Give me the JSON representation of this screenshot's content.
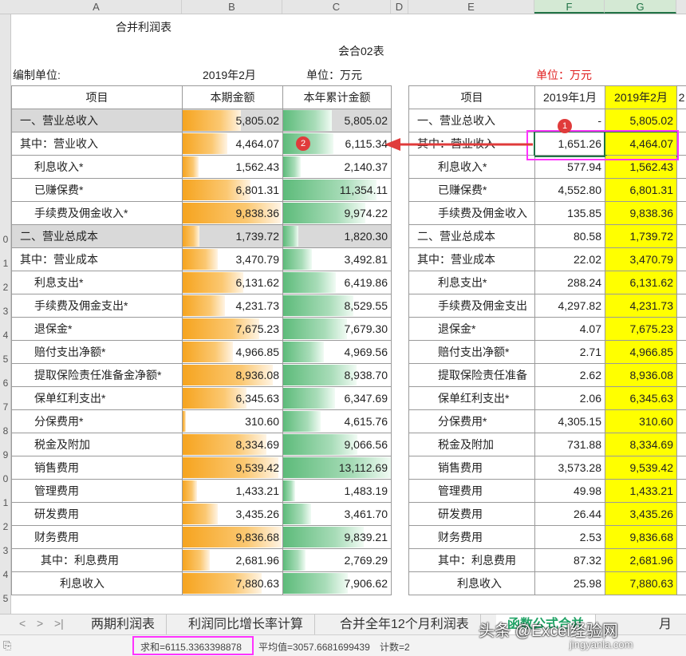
{
  "columns": [
    "A",
    "B",
    "C",
    "D",
    "E",
    "F",
    "G"
  ],
  "title": "合并利润表",
  "form_no": "会合02表",
  "left_meta": {
    "unit_prefix": "编制单位:",
    "period": "2019年2月",
    "unit": "单位：万元"
  },
  "right_unit": "单位：万元",
  "left_headers": [
    "项目",
    "本期金额",
    "本年累计金额"
  ],
  "right_headers": [
    "项目",
    "2019年1月",
    "2019年2月",
    "2"
  ],
  "row_numbers": [
    "",
    "",
    "",
    "",
    "",
    "",
    "",
    "",
    "",
    "0",
    "1",
    "2",
    "3",
    "4",
    "5",
    "6",
    "7",
    "8",
    "9",
    "0",
    "1",
    "2",
    "3",
    "4",
    "5"
  ],
  "rows": [
    {
      "label": "一、营业总收入",
      "right_label": "一、营业总收入",
      "cur": "5,805.02",
      "cum": "5,805.02",
      "jan": "-",
      "feb": "5,805.02",
      "cur_pct": 0.58,
      "cum_pct": 0.45,
      "gray": true
    },
    {
      "label": "其中：营业收入",
      "right_label": "其中：营业收入",
      "cur": "4,464.07",
      "cum": "6,115.34",
      "jan": "1,651.26",
      "feb": "4,464.07",
      "cur_pct": 0.45,
      "cum_pct": 0.47
    },
    {
      "label": "利息收入*",
      "right_label": "利息收入*",
      "cur": "1,562.43",
      "cum": "2,140.37",
      "jan": "577.94",
      "feb": "1,562.43",
      "cur_pct": 0.16,
      "cum_pct": 0.16
    },
    {
      "label": "已赚保费*",
      "right_label": "已赚保费*",
      "cur": "6,801.31",
      "cum": "11,354.11",
      "jan": "4,552.80",
      "feb": "6,801.31",
      "cur_pct": 0.68,
      "cum_pct": 0.87
    },
    {
      "label": "手续费及佣金收入*",
      "right_label": "手续费及佣金收入",
      "cur": "9,838.36",
      "cum": "9,974.22",
      "jan": "135.85",
      "feb": "9,838.36",
      "cur_pct": 0.98,
      "cum_pct": 0.76
    },
    {
      "label": "二、营业总成本",
      "right_label": "二、营业总成本",
      "cur": "1,739.72",
      "cum": "1,820.30",
      "jan": "80.58",
      "feb": "1,739.72",
      "cur_pct": 0.17,
      "cum_pct": 0.14,
      "gray": true
    },
    {
      "label": "其中：营业成本",
      "right_label": "其中：营业成本",
      "cur": "3,470.79",
      "cum": "3,492.81",
      "jan": "22.02",
      "feb": "3,470.79",
      "cur_pct": 0.35,
      "cum_pct": 0.27
    },
    {
      "label": "利息支出*",
      "right_label": "利息支出*",
      "cur": "6,131.62",
      "cum": "6,419.86",
      "jan": "288.24",
      "feb": "6,131.62",
      "cur_pct": 0.61,
      "cum_pct": 0.49
    },
    {
      "label": "手续费及佣金支出*",
      "right_label": "手续费及佣金支出",
      "cur": "4,231.73",
      "cum": "8,529.55",
      "jan": "4,297.82",
      "feb": "4,231.73",
      "cur_pct": 0.42,
      "cum_pct": 0.65
    },
    {
      "label": "退保金*",
      "right_label": "退保金*",
      "cur": "7,675.23",
      "cum": "7,679.30",
      "jan": "4.07",
      "feb": "7,675.23",
      "cur_pct": 0.77,
      "cum_pct": 0.59
    },
    {
      "label": "赔付支出净额*",
      "right_label": "赔付支出净额*",
      "cur": "4,966.85",
      "cum": "4,969.56",
      "jan": "2.71",
      "feb": "4,966.85",
      "cur_pct": 0.5,
      "cum_pct": 0.38
    },
    {
      "label": "提取保险责任准备金净额*",
      "right_label": "提取保险责任准备",
      "cur": "8,936.08",
      "cum": "8,938.70",
      "jan": "2.62",
      "feb": "8,936.08",
      "cur_pct": 0.9,
      "cum_pct": 0.68
    },
    {
      "label": "保单红利支出*",
      "right_label": "保单红利支出*",
      "cur": "6,345.63",
      "cum": "6,347.69",
      "jan": "2.06",
      "feb": "6,345.63",
      "cur_pct": 0.64,
      "cum_pct": 0.48
    },
    {
      "label": "分保费用*",
      "right_label": "分保费用*",
      "cur": "310.60",
      "cum": "4,615.76",
      "jan": "4,305.15",
      "feb": "310.60",
      "cur_pct": 0.03,
      "cum_pct": 0.35
    },
    {
      "label": "税金及附加",
      "right_label": "税金及附加",
      "cur": "8,334.69",
      "cum": "9,066.56",
      "jan": "731.88",
      "feb": "8,334.69",
      "cur_pct": 0.84,
      "cum_pct": 0.69
    },
    {
      "label": "销售费用",
      "right_label": "销售费用",
      "cur": "9,539.42",
      "cum": "13,112.69",
      "jan": "3,573.28",
      "feb": "9,539.42",
      "cur_pct": 0.96,
      "cum_pct": 1.0
    },
    {
      "label": "管理费用",
      "right_label": "管理费用",
      "cur": "1,433.21",
      "cum": "1,483.19",
      "jan": "49.98",
      "feb": "1,433.21",
      "cur_pct": 0.14,
      "cum_pct": 0.11
    },
    {
      "label": "研发费用",
      "right_label": "研发费用",
      "cur": "3,435.26",
      "cum": "3,461.70",
      "jan": "26.44",
      "feb": "3,435.26",
      "cur_pct": 0.35,
      "cum_pct": 0.26
    },
    {
      "label": "财务费用",
      "right_label": "财务费用",
      "cur": "9,836.68",
      "cum": "9,839.21",
      "jan": "2.53",
      "feb": "9,836.68",
      "cur_pct": 0.99,
      "cum_pct": 0.75
    },
    {
      "label": "其中：利息费用",
      "right_label": "其中：利息费用",
      "cur": "2,681.96",
      "cum": "2,769.29",
      "jan": "87.32",
      "feb": "2,681.96",
      "cur_pct": 0.27,
      "cum_pct": 0.21
    },
    {
      "label": "利息收入",
      "right_label": "利息收入",
      "cur": "7,880.63",
      "cum": "7,906.62",
      "jan": "25.98",
      "feb": "7,880.63",
      "cur_pct": 0.79,
      "cum_pct": 0.6
    }
  ],
  "indent": [
    1,
    1,
    2,
    2,
    2,
    1,
    1,
    2,
    2,
    2,
    2,
    2,
    2,
    2,
    2,
    2,
    2,
    2,
    2,
    3,
    4
  ],
  "markers": [
    "1",
    "2"
  ],
  "sheet_tabs": [
    "两期利润表",
    "利润同比增长率计算",
    "合并全年12个月利润表",
    "函数公式合并",
    "月"
  ],
  "nav": [
    "<",
    ">",
    ">|"
  ],
  "status": {
    "sum": "求和=6115.3363398878",
    "avg": "平均值=3057.6681699439",
    "count": "计数=2"
  },
  "watermark": "头条 @Excel经验网",
  "watermark_url": "jingyanla.com",
  "colors": {
    "accent_green": "#217346",
    "highlight_yellow": "#ffff00",
    "magenta": "#ff33ff",
    "red": "#e03b3b"
  }
}
